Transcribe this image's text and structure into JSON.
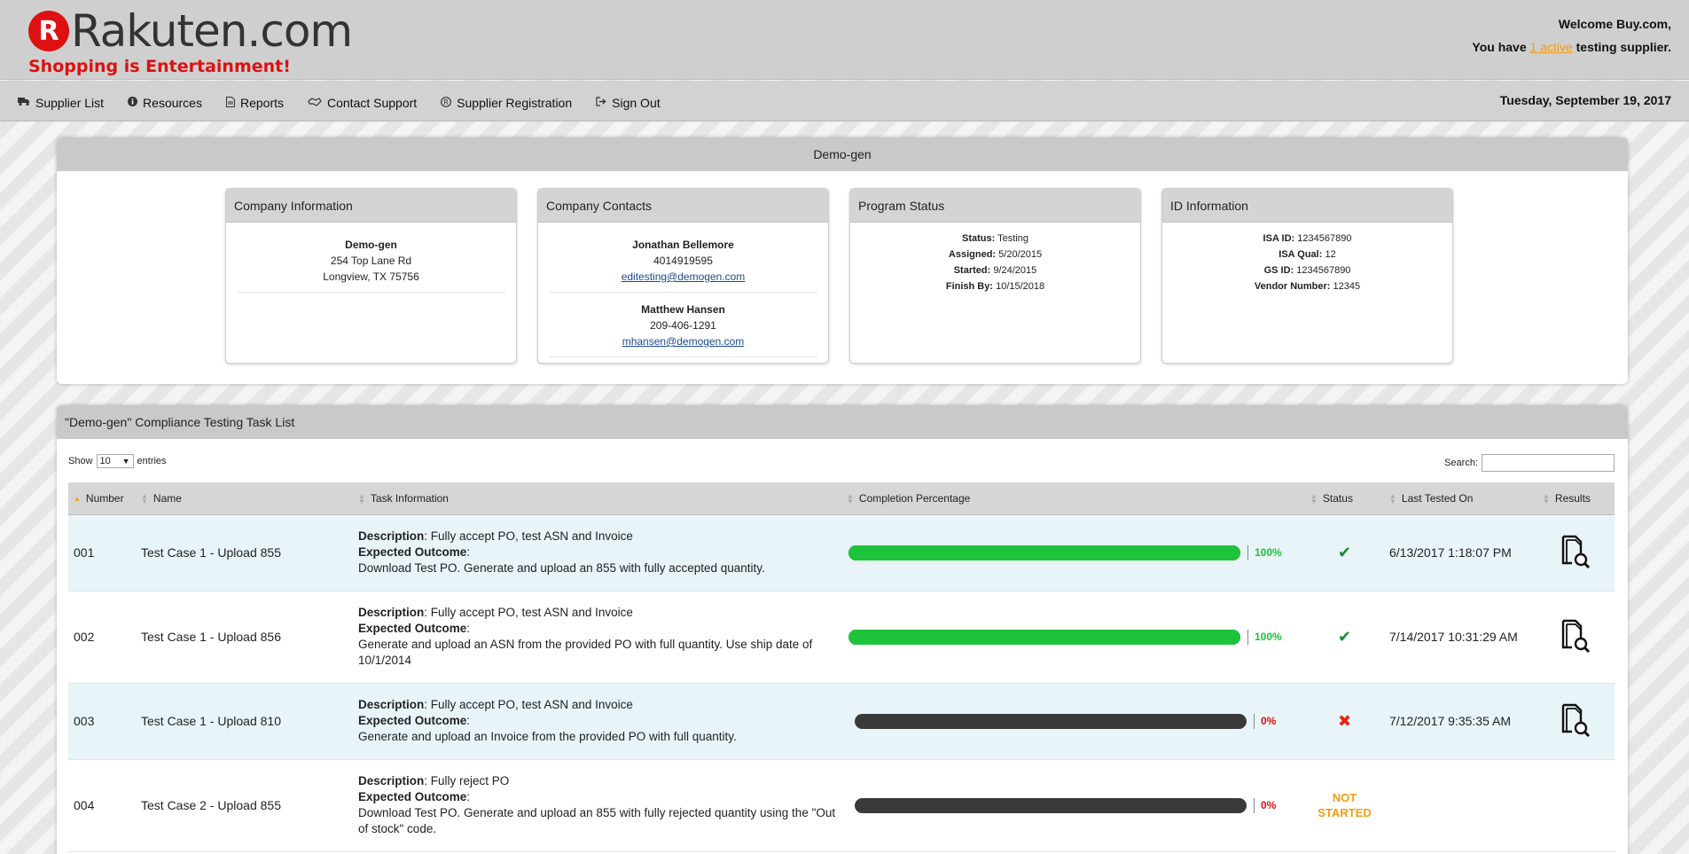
{
  "header": {
    "logo_badge": "R",
    "logo_text": "Rakuten.com",
    "logo_tagline": "Shopping is Entertainment!",
    "welcome_text": "Welcome Buy.com,",
    "supplier_prefix": "You have",
    "active_link": "1 active",
    "supplier_suffix": "testing supplier."
  },
  "nav": {
    "items": [
      {
        "label": "Supplier List",
        "icon": "truck-icon"
      },
      {
        "label": "Resources",
        "icon": "info-icon"
      },
      {
        "label": "Reports",
        "icon": "document-icon"
      },
      {
        "label": "Contact Support",
        "icon": "handshake-icon"
      },
      {
        "label": "Supplier Registration",
        "icon": "registered-icon"
      },
      {
        "label": "Sign Out",
        "icon": "sign-out-icon"
      }
    ],
    "date": "Tuesday, September 19, 2017"
  },
  "company_panel": {
    "title": "Demo-gen",
    "company_info": {
      "header": "Company Information",
      "name": "Demo-gen",
      "address1": "254 Top Lane Rd",
      "address2": "Longview, TX 75756"
    },
    "contacts": {
      "header": "Company Contacts",
      "people": [
        {
          "name": "Jonathan Bellemore",
          "phone": "4014919595",
          "email": "editesting@demogen.com"
        },
        {
          "name": "Matthew Hansen",
          "phone": "209-406-1291",
          "email": "mhansen@demogen.com"
        }
      ]
    },
    "program_status": {
      "header": "Program Status",
      "status_label": "Status:",
      "status_value": "Testing",
      "assigned_label": "Assigned:",
      "assigned_value": "5/20/2015",
      "started_label": "Started:",
      "started_value": "9/24/2015",
      "finish_label": "Finish By:",
      "finish_value": "10/15/2018"
    },
    "id_info": {
      "header": "ID Information",
      "isa_id_label": "ISA ID:",
      "isa_id_value": "1234567890",
      "isa_qual_label": "ISA Qual:",
      "isa_qual_value": "12",
      "gs_id_label": "GS ID:",
      "gs_id_value": "1234567890",
      "vendor_label": "Vendor Number:",
      "vendor_value": "12345"
    }
  },
  "task_panel": {
    "title": "\"Demo-gen\" Compliance Testing Task List",
    "show_label": "Show",
    "entries_value": "10",
    "entries_label": "entries",
    "search_label": "Search:",
    "search_value": "",
    "columns": [
      "Number",
      "Name",
      "Task Information",
      "Completion Percentage",
      "Status",
      "Last Tested On",
      "Results"
    ],
    "desc_label": "Description",
    "outcome_label": "Expected Outcome",
    "rows": [
      {
        "number": "001",
        "name": "Test Case 1 - Upload 855",
        "description": ": Fully accept PO, test ASN and Invoice",
        "outcome": "Download Test PO. Generate and upload an 855 with fully accepted quantity.",
        "percent": 100,
        "percent_label": "100%",
        "status": "check",
        "last_tested": "6/13/2017 1:18:07 PM"
      },
      {
        "number": "002",
        "name": "Test Case 1 - Upload 856",
        "description": ": Fully accept PO, test ASN and Invoice",
        "outcome": "Generate and upload an ASN from the provided PO with full quantity. Use ship date of 10/1/2014",
        "percent": 100,
        "percent_label": "100%",
        "status": "check",
        "last_tested": "7/14/2017 10:31:29 AM"
      },
      {
        "number": "003",
        "name": "Test Case 1 - Upload 810",
        "description": ": Fully accept PO, test ASN and Invoice",
        "outcome": "Generate and upload an Invoice from the provided PO with full quantity.",
        "percent": 0,
        "percent_label": "0%",
        "status": "x",
        "last_tested": "7/12/2017 9:35:35 AM"
      },
      {
        "number": "004",
        "name": "Test Case 2 - Upload 855",
        "description": ": Fully reject PO",
        "outcome": "Download Test PO. Generate and upload an 855 with fully rejected quantity using the \"Out of stock\" code.",
        "percent": 0,
        "percent_label": "0%",
        "status": "not-started",
        "status_text_1": "NOT",
        "status_text_2": "STARTED",
        "last_tested": ""
      }
    ]
  },
  "colors": {
    "progress_green": "#1dc33a",
    "progress_dark": "#3a3a3a",
    "brand_red": "#dd1111",
    "link_orange": "#f39c12"
  }
}
